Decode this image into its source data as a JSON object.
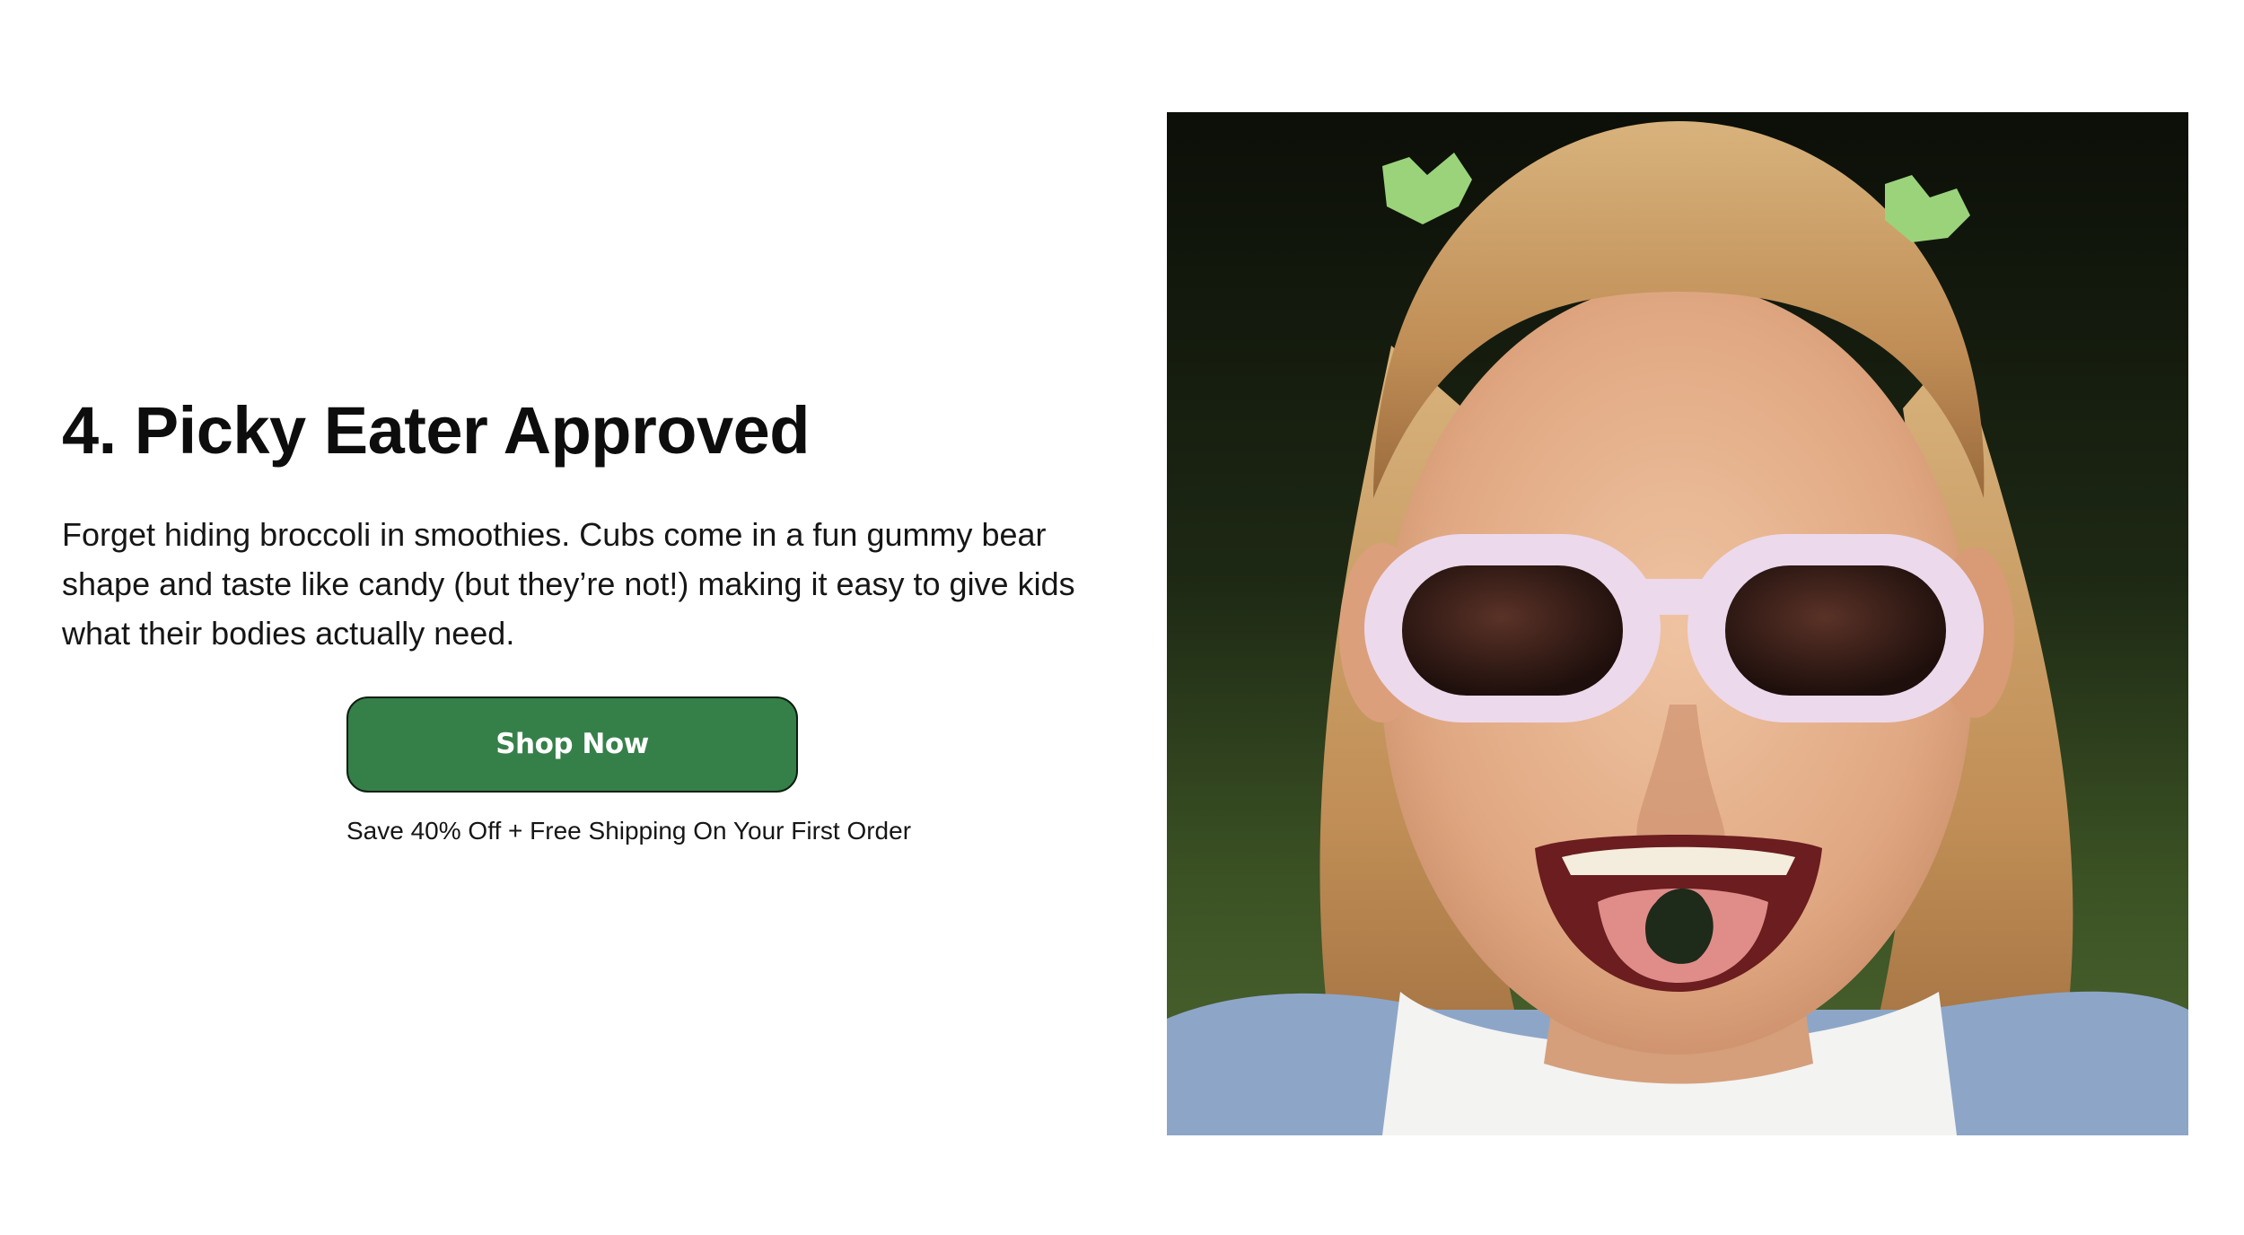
{
  "section": {
    "heading": "4. Picky Eater Approved",
    "body": "Forget hiding broccoli in smoothies. Cubs come in a fun gummy bear shape and taste like candy (but they’re not!) making it easy to give kids what their bodies actually need.",
    "cta": {
      "label": "Shop Now",
      "offer_text": "Save 40% Off + Free Shipping On Your First Order"
    }
  },
  "colors": {
    "button_bg": "#358049",
    "button_border": "#0b1f10",
    "text": "#111111",
    "background": "#ffffff"
  },
  "image": {
    "subject": "smiling-girl-sunglasses-gummy-bear-photo"
  }
}
